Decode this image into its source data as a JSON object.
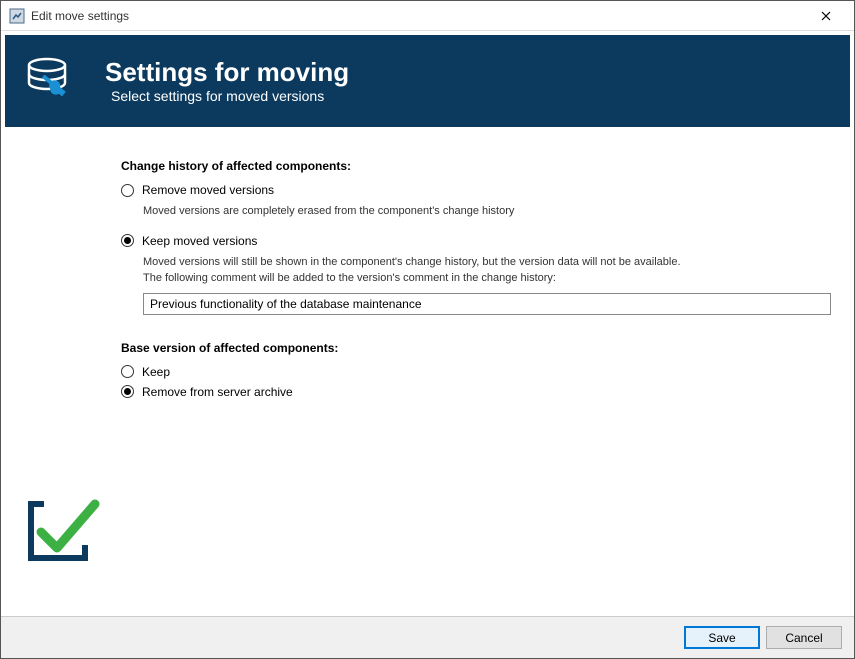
{
  "window": {
    "title": "Edit move settings"
  },
  "header": {
    "title": "Settings for moving",
    "subtitle": "Select settings for moved versions"
  },
  "changeHistory": {
    "heading": "Change history of affected components:",
    "remove": {
      "label": "Remove moved versions",
      "desc": "Moved versions are completely erased from the component's change history"
    },
    "keep": {
      "label": "Keep moved versions",
      "desc1": "Moved versions will still be shown in the component's change history, but the version data will not be available.",
      "desc2": "The following comment will be added to the version's comment in the change history:",
      "commentValue": "Previous functionality of the database maintenance"
    },
    "selected": "keep"
  },
  "baseVersion": {
    "heading": "Base version of affected components:",
    "keep": {
      "label": "Keep"
    },
    "remove": {
      "label": "Remove from server archive"
    },
    "selected": "remove"
  },
  "buttons": {
    "save": "Save",
    "cancel": "Cancel"
  }
}
